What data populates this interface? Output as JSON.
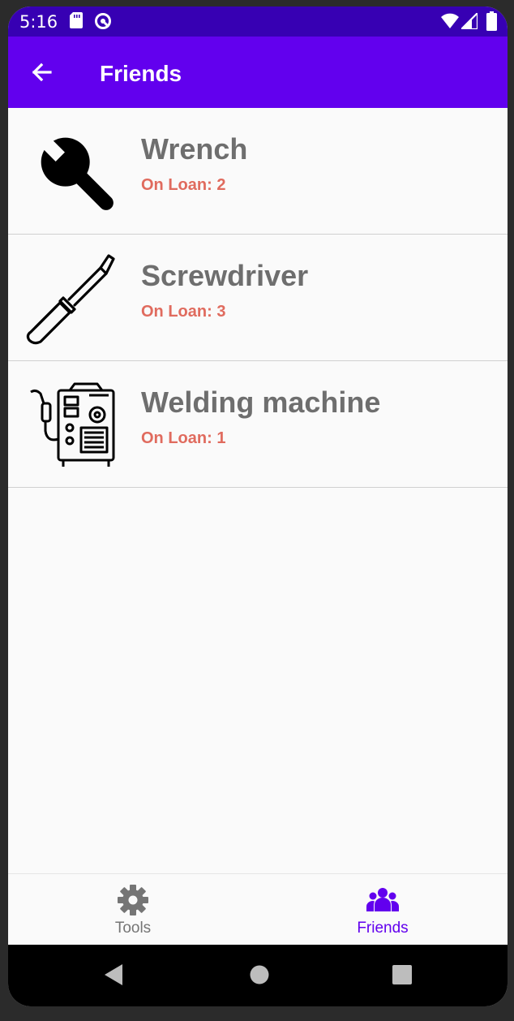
{
  "status_bar": {
    "time": "5:16"
  },
  "app_bar": {
    "title": "Friends"
  },
  "items": [
    {
      "name": "Wrench",
      "loan": "On Loan: 2",
      "icon": "wrench-icon"
    },
    {
      "name": "Screwdriver",
      "loan": "On Loan: 3",
      "icon": "screwdriver-icon"
    },
    {
      "name": "Welding machine",
      "loan": "On Loan: 1",
      "icon": "welding-machine-icon"
    }
  ],
  "bottom_nav": {
    "tools_label": "Tools",
    "friends_label": "Friends",
    "active": "friends"
  },
  "colors": {
    "app_bar": "#6200ee",
    "status_bar": "#3700b3",
    "loan_text": "#e06b5e",
    "active_nav": "#6200ee",
    "inactive_nav": "#757575"
  }
}
